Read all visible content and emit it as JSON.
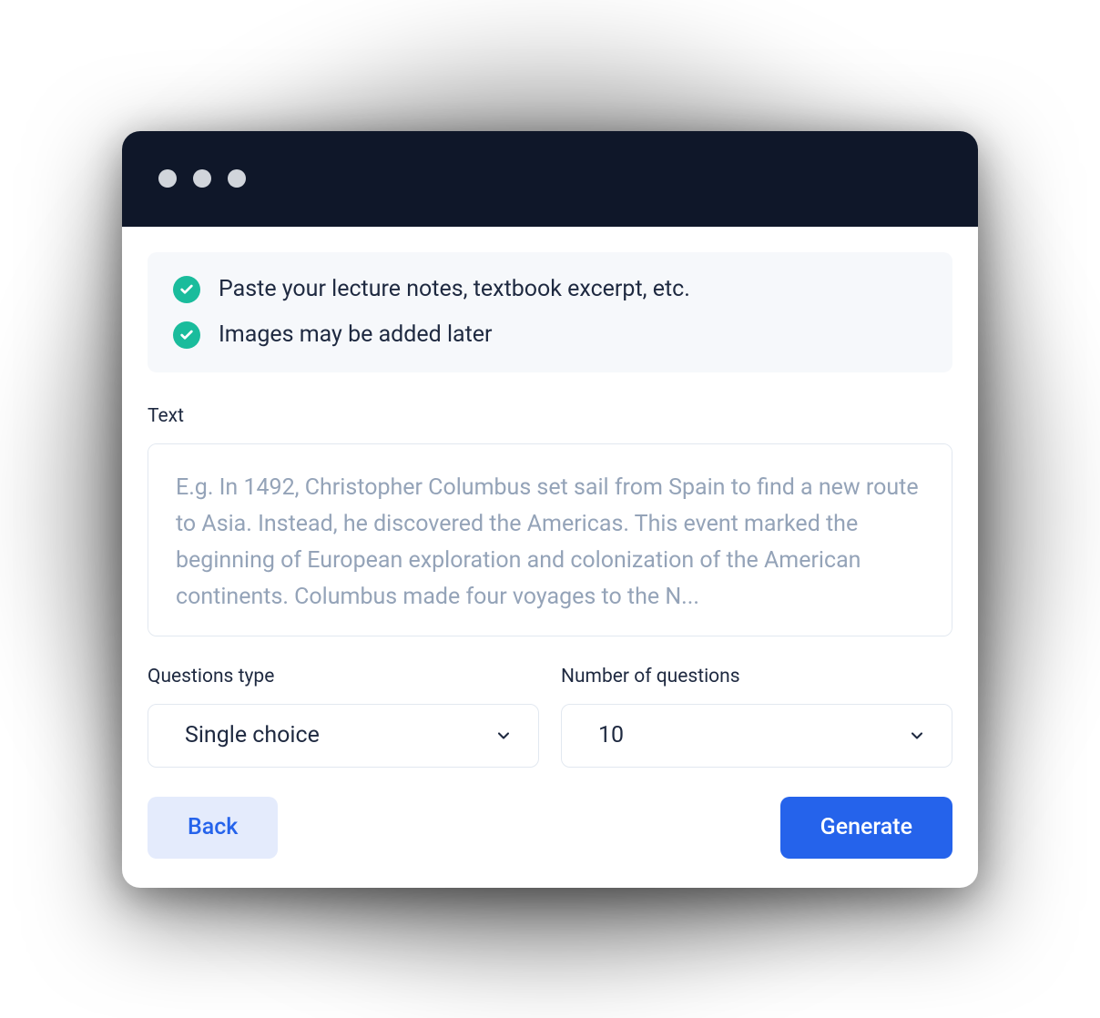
{
  "info": {
    "items": [
      "Paste your lecture notes, textbook excerpt, etc.",
      "Images may be added later"
    ]
  },
  "text_field": {
    "label": "Text",
    "placeholder": "E.g. In 1492, Christopher Columbus set sail from Spain to find a new route to Asia. Instead, he discovered the Americas. This event marked the beginning of European exploration and colonization of the American continents. Columbus made four voyages to the N..."
  },
  "questions_type": {
    "label": "Questions type",
    "value": "Single choice"
  },
  "number_of_questions": {
    "label": "Number of questions",
    "value": "10"
  },
  "actions": {
    "back_label": "Back",
    "generate_label": "Generate"
  }
}
